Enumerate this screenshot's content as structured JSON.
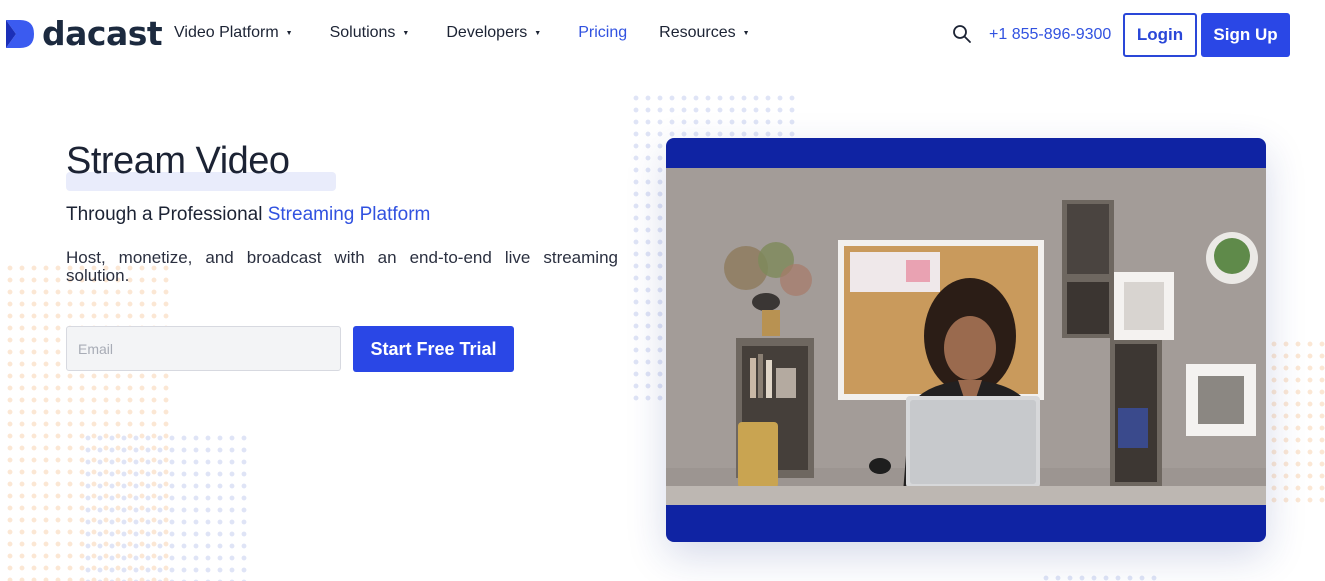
{
  "header": {
    "logo_text": "dacast",
    "nav": [
      {
        "label": "Video Platform",
        "dropdown": true
      },
      {
        "label": "Solutions",
        "dropdown": true
      },
      {
        "label": "Developers",
        "dropdown": true
      },
      {
        "label": "Pricing",
        "dropdown": false
      },
      {
        "label": "Resources",
        "dropdown": true
      }
    ],
    "search_icon": "search-icon",
    "phone": "+1 855-896-9300",
    "login_label": "Login",
    "signup_label": "Sign Up"
  },
  "hero": {
    "title": "Stream Video",
    "subtitle_prefix": "Through a Professional ",
    "subtitle_accent": "Streaming Platform",
    "description": "Host, monetize, and broadcast with an end-to-end live streaming solution.",
    "email_placeholder": "Email",
    "trial_label": "Start Free Trial"
  },
  "colors": {
    "brand_blue": "#2a47e6",
    "accent_text": "#3152e0",
    "video_frame": "#0f23a3",
    "dark_text": "#1c2334"
  }
}
